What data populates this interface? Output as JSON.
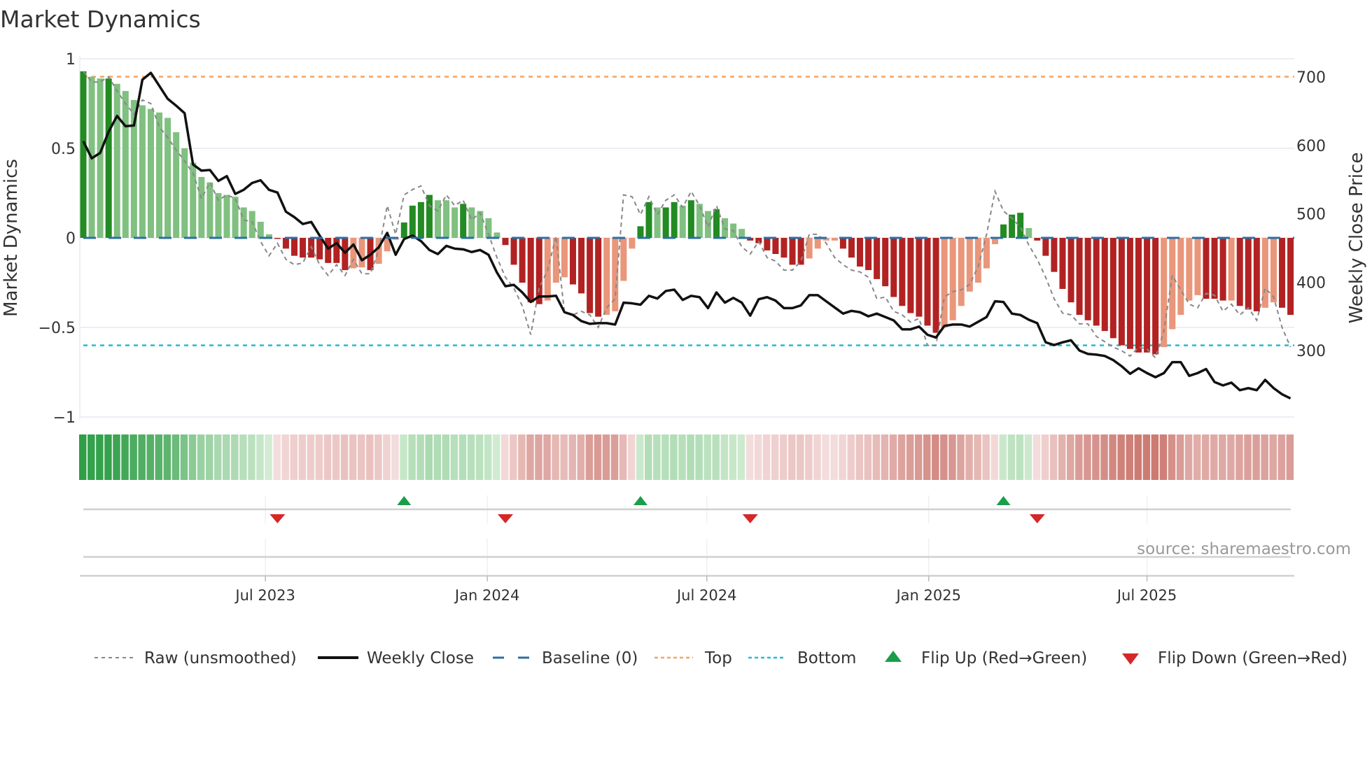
{
  "chart_data": {
    "type": "bar",
    "title": "Market Dynamics",
    "ylabel": "Market Dynamics",
    "ylabel_right": "Weekly Close Price",
    "ylim": [
      -1,
      1
    ],
    "ylim_right_ticks": [
      300,
      400,
      500,
      600,
      700
    ],
    "yticks": [
      {
        "v": 1,
        "label": "1"
      },
      {
        "v": 0.5,
        "label": "0.5"
      },
      {
        "v": 0,
        "label": "0"
      },
      {
        "v": -0.5,
        "label": "−0.5"
      },
      {
        "v": -1,
        "label": "−1"
      }
    ],
    "yticks_right": [
      {
        "v": 700,
        "label": "700"
      },
      {
        "v": 600,
        "label": "600"
      },
      {
        "v": 500,
        "label": "500"
      },
      {
        "v": 400,
        "label": "400"
      },
      {
        "v": 300,
        "label": "300"
      }
    ],
    "x_start": "2023-01-31",
    "x_frequency": "weekly",
    "xticks": [
      {
        "date": "2023-07-01",
        "label": "Jul 2023"
      },
      {
        "date": "2024-01-01",
        "label": "Jan 2024"
      },
      {
        "date": "2024-07-01",
        "label": "Jul 2024"
      },
      {
        "date": "2025-01-01",
        "label": "Jan 2025"
      },
      {
        "date": "2025-07-01",
        "label": "Jul 2025"
      }
    ],
    "top": 0.9,
    "bottom": -0.6,
    "baseline": 0,
    "smoothed": [
      0.93,
      0.9,
      0.89,
      0.89,
      0.86,
      0.82,
      0.77,
      0.74,
      0.72,
      0.7,
      0.67,
      0.59,
      0.5,
      0.42,
      0.34,
      0.31,
      0.25,
      0.24,
      0.23,
      0.17,
      0.15,
      0.09,
      0.02,
      -0.005,
      -0.06,
      -0.1,
      -0.11,
      -0.11,
      -0.12,
      -0.14,
      -0.14,
      -0.18,
      -0.17,
      -0.165,
      -0.18,
      -0.145,
      -0.075,
      -0.01,
      0.086,
      0.18,
      0.2,
      0.24,
      0.21,
      0.21,
      0.17,
      0.19,
      0.17,
      0.15,
      0.11,
      0.03,
      -0.04,
      -0.15,
      -0.25,
      -0.36,
      -0.37,
      -0.35,
      -0.25,
      -0.22,
      -0.26,
      -0.31,
      -0.42,
      -0.44,
      -0.43,
      -0.41,
      -0.24,
      -0.06,
      0.065,
      0.2,
      0.17,
      0.17,
      0.2,
      0.18,
      0.21,
      0.19,
      0.15,
      0.16,
      0.11,
      0.08,
      0.05,
      -0.015,
      -0.03,
      -0.07,
      -0.09,
      -0.11,
      -0.15,
      -0.15,
      -0.115,
      -0.06,
      -0.015,
      -0.015,
      -0.06,
      -0.11,
      -0.16,
      -0.18,
      -0.23,
      -0.27,
      -0.33,
      -0.38,
      -0.42,
      -0.44,
      -0.49,
      -0.53,
      -0.5,
      -0.46,
      -0.38,
      -0.3,
      -0.25,
      -0.17,
      -0.035,
      0.075,
      0.13,
      0.14,
      0.055,
      -0.015,
      -0.1,
      -0.19,
      -0.285,
      -0.36,
      -0.43,
      -0.46,
      -0.49,
      -0.52,
      -0.56,
      -0.6,
      -0.62,
      -0.64,
      -0.64,
      -0.65,
      -0.61,
      -0.51,
      -0.43,
      -0.35,
      -0.32,
      -0.34,
      -0.34,
      -0.35,
      -0.35,
      -0.38,
      -0.4,
      -0.41,
      -0.39,
      -0.36,
      -0.39,
      -0.43
    ],
    "strengthening": [
      1,
      0,
      0,
      1,
      0,
      0,
      0,
      0,
      0,
      0,
      0,
      0,
      0,
      0,
      0,
      0,
      0,
      0,
      0,
      0,
      0,
      0,
      0,
      1,
      1,
      1,
      1,
      1,
      1,
      1,
      1,
      1,
      0,
      0,
      1,
      0,
      0,
      0,
      1,
      1,
      1,
      1,
      0,
      0,
      0,
      1,
      0,
      0,
      0,
      0,
      1,
      1,
      1,
      1,
      1,
      0,
      0,
      0,
      1,
      1,
      1,
      1,
      0,
      0,
      0,
      0,
      1,
      1,
      0,
      1,
      1,
      0,
      1,
      0,
      0,
      1,
      0,
      0,
      0,
      1,
      1,
      1,
      1,
      1,
      1,
      1,
      0,
      0,
      0,
      0,
      1,
      1,
      1,
      1,
      1,
      1,
      1,
      1,
      1,
      1,
      1,
      1,
      0,
      0,
      0,
      0,
      0,
      0,
      0,
      1,
      1,
      1,
      0,
      1,
      1,
      1,
      1,
      1,
      1,
      1,
      1,
      1,
      1,
      1,
      1,
      1,
      1,
      1,
      0,
      0,
      0,
      0,
      0,
      1,
      1,
      1,
      0,
      1,
      1,
      1,
      0,
      0,
      1,
      1
    ],
    "raw": [
      0.93,
      0.87,
      0.87,
      0.9,
      0.82,
      0.75,
      0.69,
      0.77,
      0.75,
      0.62,
      0.56,
      0.49,
      0.43,
      0.36,
      0.22,
      0.31,
      0.21,
      0.24,
      0.22,
      0.1,
      0.09,
      -0.02,
      -0.1,
      -0.03,
      -0.12,
      -0.15,
      -0.14,
      -0.05,
      -0.15,
      -0.21,
      -0.15,
      -0.21,
      -0.12,
      -0.2,
      -0.2,
      -0.07,
      0.18,
      0.02,
      0.24,
      0.27,
      0.29,
      0.18,
      0.15,
      0.24,
      0.18,
      0.21,
      0.1,
      0.14,
      0.02,
      -0.11,
      -0.22,
      -0.28,
      -0.38,
      -0.54,
      -0.28,
      -0.18,
      0.01,
      -0.42,
      -0.43,
      -0.41,
      -0.43,
      -0.5,
      -0.39,
      -0.34,
      0.24,
      0.23,
      0.13,
      0.23,
      0.13,
      0.21,
      0.24,
      0.17,
      0.26,
      0.18,
      0.06,
      0.18,
      0.05,
      0.04,
      -0.05,
      -0.09,
      -0.02,
      -0.11,
      -0.13,
      -0.18,
      -0.18,
      -0.13,
      0.02,
      0.02,
      -0.03,
      -0.11,
      -0.15,
      -0.18,
      -0.19,
      -0.22,
      -0.34,
      -0.33,
      -0.41,
      -0.43,
      -0.47,
      -0.45,
      -0.6,
      -0.6,
      -0.33,
      -0.3,
      -0.29,
      -0.26,
      -0.16,
      0.02,
      0.26,
      0.15,
      0.11,
      0.06,
      -0.04,
      -0.12,
      -0.22,
      -0.34,
      -0.42,
      -0.43,
      -0.48,
      -0.48,
      -0.55,
      -0.58,
      -0.61,
      -0.63,
      -0.66,
      -0.61,
      -0.62,
      -0.67,
      -0.52,
      -0.21,
      -0.29,
      -0.37,
      -0.39,
      -0.31,
      -0.32,
      -0.41,
      -0.37,
      -0.43,
      -0.39,
      -0.46,
      -0.28,
      -0.33,
      -0.5,
      -0.61
    ],
    "close": [
      606,
      581,
      589,
      620,
      643,
      628,
      629,
      696,
      706,
      687,
      668,
      658,
      647,
      572,
      563,
      564,
      548,
      555,
      529,
      535,
      545,
      549,
      535,
      531,
      503,
      495,
      485,
      488,
      468,
      449,
      457,
      443,
      455,
      432,
      440,
      451,
      472,
      440,
      463,
      468,
      460,
      447,
      441,
      453,
      449,
      448,
      444,
      447,
      440,
      414,
      394,
      396,
      385,
      371,
      379,
      379,
      380,
      356,
      352,
      343,
      339,
      340,
      340,
      338,
      370,
      369,
      367,
      380,
      376,
      387,
      389,
      374,
      380,
      378,
      362,
      385,
      370,
      377,
      370,
      351,
      375,
      378,
      373,
      362,
      362,
      366,
      381,
      381,
      372,
      363,
      354,
      358,
      356,
      350,
      354,
      349,
      344,
      331,
      331,
      335,
      323,
      319,
      336,
      338,
      338,
      335,
      342,
      349,
      372,
      371,
      354,
      352,
      345,
      340,
      312,
      308,
      312,
      315,
      300,
      295,
      294,
      292,
      286,
      277,
      266,
      274,
      267,
      261,
      267,
      283,
      283,
      263,
      267,
      273,
      254,
      249,
      253,
      242,
      245,
      242,
      257,
      245,
      236,
      230
    ],
    "flip_up_index": [
      38,
      66,
      109
    ],
    "flip_down_index": [
      23,
      50,
      79,
      113
    ],
    "legend": [
      {
        "key": "raw",
        "label": "Raw (unsmoothed)"
      },
      {
        "key": "close",
        "label": "Weekly Close"
      },
      {
        "key": "baseline",
        "label": "Baseline (0)"
      },
      {
        "key": "top",
        "label": "Top"
      },
      {
        "key": "bottom",
        "label": "Bottom"
      },
      {
        "key": "flip_up",
        "label": "Flip Up (Red→Green)"
      },
      {
        "key": "flip_down",
        "label": "Flip Down (Green→Red)"
      }
    ],
    "legend_placement": "bottom",
    "grid": true,
    "source": "source: sharemaestro.com",
    "colors": {
      "pos_strong": "#228b22",
      "pos_weak": "#80c080",
      "neg_strong": "#b22222",
      "neg_weak": "#e9967a",
      "raw": "#888888",
      "close": "#111111",
      "baseline": "#2e6fa3",
      "top": "#f4a460",
      "bottom": "#22bcd4",
      "flip_up": "#1a9e4a",
      "flip_down": "#d62728"
    }
  }
}
